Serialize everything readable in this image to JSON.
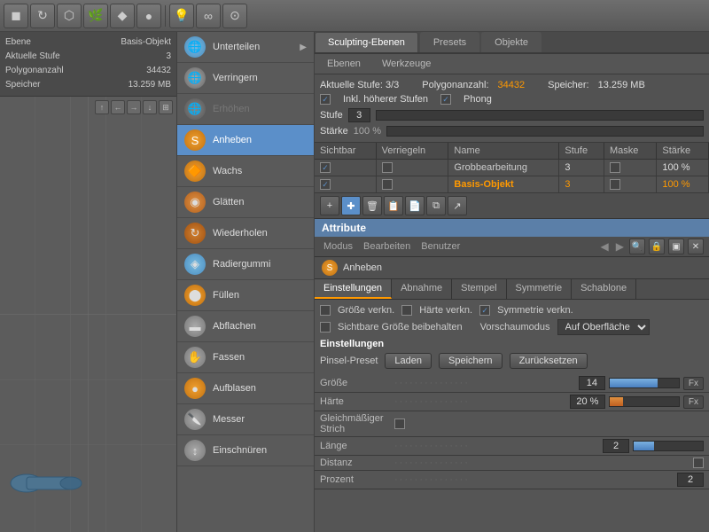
{
  "app": {
    "title": "Sculpting",
    "tabs": [
      "Sculpting-Ebenen",
      "Presets",
      "Objekte"
    ],
    "active_tab": "Sculpting-Ebenen"
  },
  "toolbar": {
    "tools": [
      "🔲",
      "🔄",
      "⬡",
      "🌿",
      "🔶",
      "🔵",
      "💡"
    ]
  },
  "left_info": {
    "ebene_label": "Ebene",
    "ebene_value": "Basis-Objekt",
    "stufe_label": "Aktuelle Stufe",
    "stufe_value": "3",
    "polygone_label": "Polygonanzahl",
    "polygone_value": "34432",
    "speicher_label": "Speicher",
    "speicher_value": "13.259 MB"
  },
  "header_info": {
    "stufe_label": "Aktuelle Stufe: 3/3",
    "polygone_label": "Polygonanzahl:",
    "polygone_value": "34432",
    "speicher_label": "Speicher:",
    "speicher_value": "13.259 MB"
  },
  "layer_controls": {
    "inkl_label": "Inkl. höherer Stufen",
    "phong_label": "Phong",
    "stufe_label": "Stufe",
    "stufe_value": "3",
    "staerke_label": "Stärke",
    "staerke_value": "100 %"
  },
  "layers_table": {
    "headers": [
      "Sichtbar",
      "Verriegeln",
      "Name",
      "Stufe",
      "Maske",
      "Stärke"
    ],
    "rows": [
      {
        "sichtbar": "✓",
        "verriegeln": "",
        "name": "Grobbearbeitung",
        "stufe": "3",
        "maske": "",
        "staerke": "100 %",
        "active": false
      },
      {
        "sichtbar": "✓",
        "verriegeln": "",
        "name": "Basis-Objekt",
        "stufe": "3",
        "maske": "",
        "staerke": "100 %",
        "active": true
      }
    ]
  },
  "icon_toolbar": {
    "icons": [
      "➕",
      "✏️",
      "🗑",
      "📋",
      "📄",
      "📋",
      "📑"
    ]
  },
  "attribute": {
    "label": "Attribute"
  },
  "modus_row": {
    "items": [
      "Modus",
      "Bearbeiten",
      "Benutzer"
    ]
  },
  "brush": {
    "name": "Anheben",
    "tabs": [
      "Einstellungen",
      "Abnahme",
      "Stempel",
      "Symmetrie",
      "Schablone"
    ],
    "active_tab": "Einstellungen"
  },
  "brush_settings": {
    "groesse_vern_label": "Größe verkn.",
    "haerte_vern_label": "Härte verkn.",
    "symmetrie_vern_label": "Symmetrie verkn.",
    "sichtbare_label": "Sichtbare Größe beibehalten",
    "vorschau_label": "Vorschaumodus",
    "vorschau_value": "Auf Oberfläche",
    "einstellungen_label": "Einstellungen",
    "pinsel_label": "Pinsel-Preset",
    "laden_label": "Laden",
    "speichern_label": "Speichern",
    "zurueck_label": "Zurücksetzen",
    "groesse_label": "Größe",
    "groesse_dots": "...............",
    "groesse_value": "14",
    "groesse_pct": 70,
    "haerte_label": "Härte",
    "haerte_dots": "...............",
    "haerte_value": "20 %",
    "haerte_pct": 20,
    "gleichmaessig_label": "Gleichmäßiger Strich",
    "laenge_label": "Länge",
    "laenge_dots": "...............",
    "laenge_value": "2",
    "laenge_pct": 40,
    "distanz_label": "Distanz",
    "distanz_dots": "...............",
    "prozent_label": "Prozent",
    "prozent_value": "2"
  },
  "menu_items": [
    {
      "label": "Unterteilen",
      "color": "#aaa",
      "icon": "🌐"
    },
    {
      "label": "Verringern",
      "color": "#aaa",
      "icon": "🌐"
    },
    {
      "label": "Erhöhen",
      "color": "#777",
      "icon": "🌐"
    },
    {
      "label": "Anheben",
      "color": "#f90",
      "icon": "🔶",
      "active": true
    },
    {
      "label": "Wachs",
      "color": "#f90",
      "icon": "🔶"
    },
    {
      "label": "Glätten",
      "color": "#f90",
      "icon": "🔶"
    },
    {
      "label": "Wiederholen",
      "color": "#f90",
      "icon": "🔶"
    },
    {
      "label": "Radiergummi",
      "color": "#aaa",
      "icon": "🔷"
    },
    {
      "label": "Füllen",
      "color": "#f90",
      "icon": "🔶"
    },
    {
      "label": "Abflachen",
      "color": "#aaa",
      "icon": "🔷"
    },
    {
      "label": "Fassen",
      "color": "#aaa",
      "icon": "🔷"
    },
    {
      "label": "Aufblasen",
      "color": "#f90",
      "icon": "🔶"
    },
    {
      "label": "Messer",
      "color": "#aaa",
      "icon": "🔷"
    },
    {
      "label": "Einschnüren",
      "color": "#aaa",
      "icon": "🔷"
    }
  ]
}
